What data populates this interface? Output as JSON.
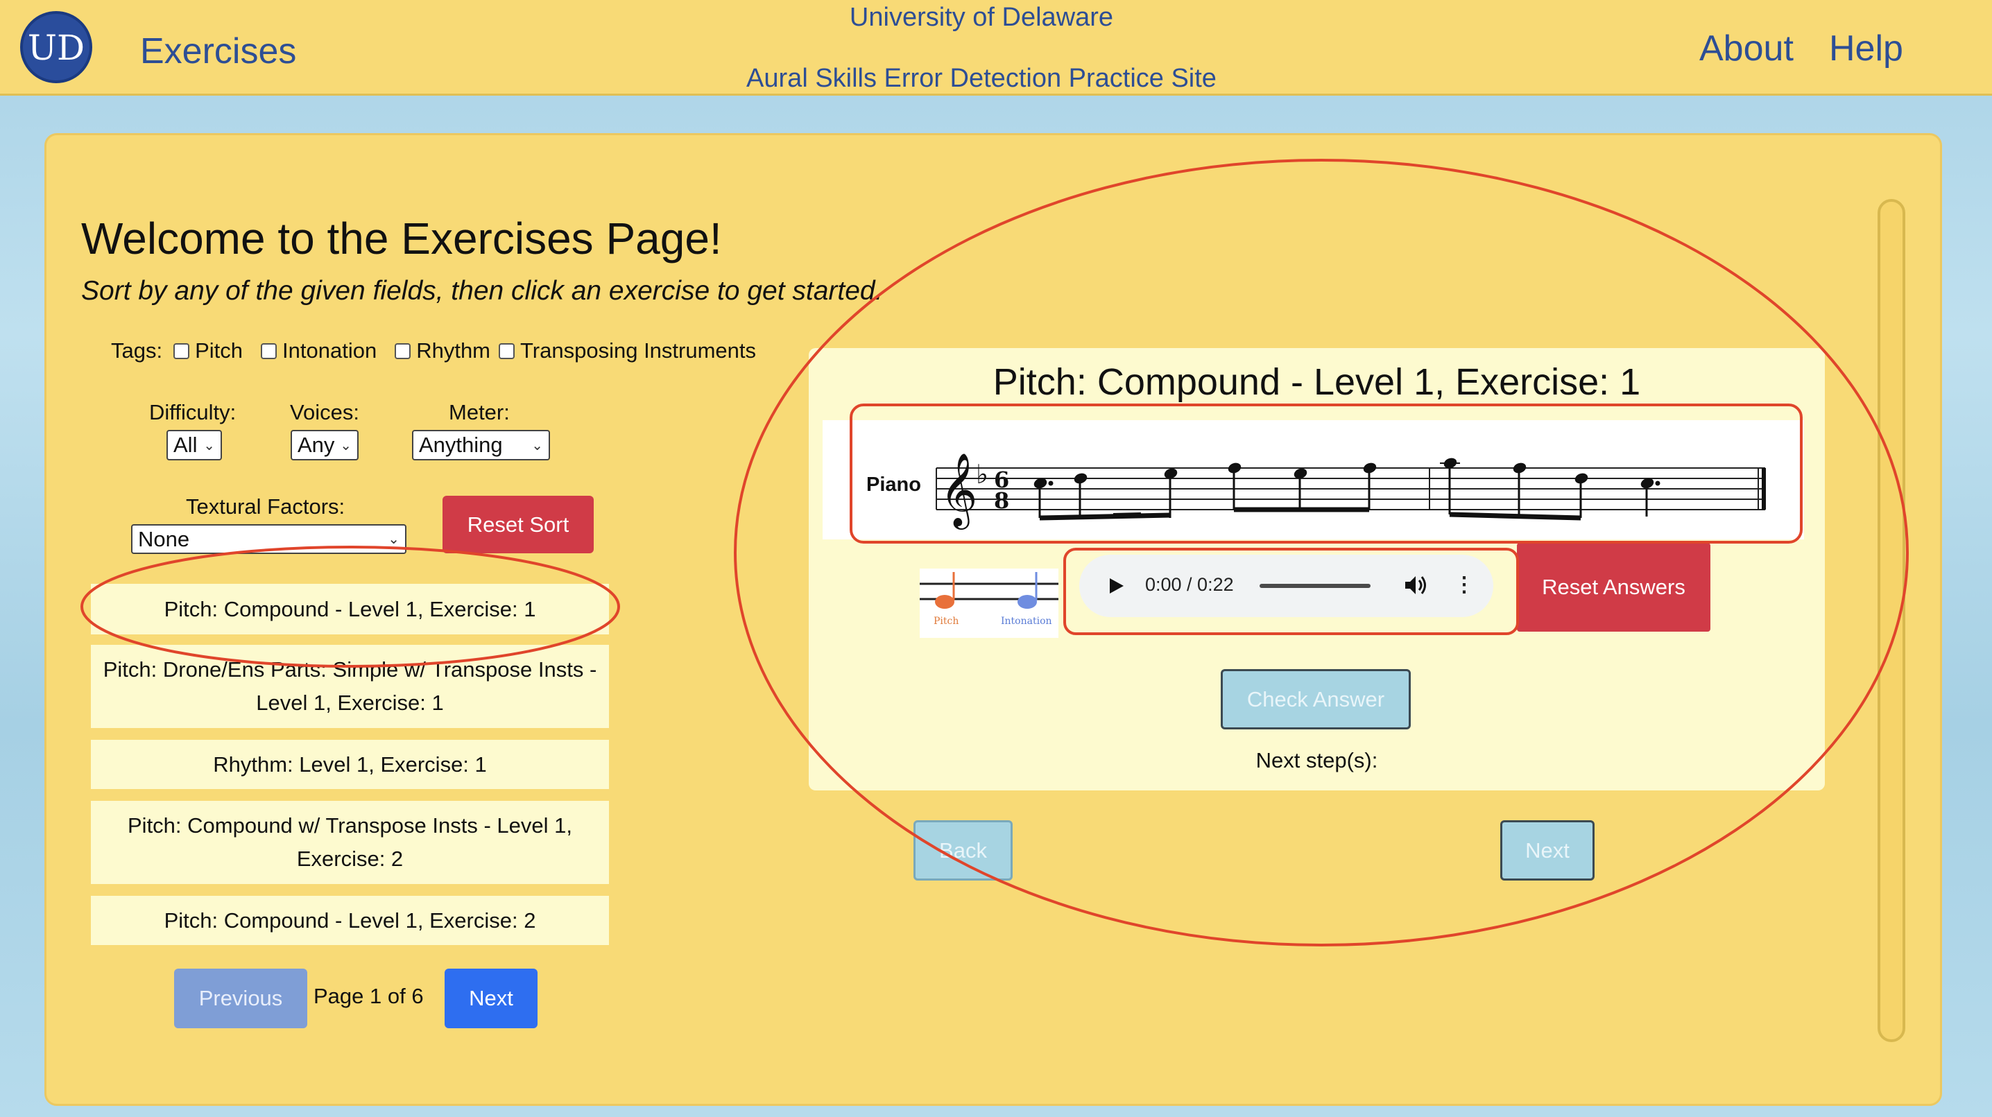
{
  "header": {
    "logo_text": "UD",
    "brand": "Exercises",
    "line1": "University of Delaware",
    "line2": "Aural Skills Error Detection Practice Site",
    "nav": {
      "about": "About",
      "help": "Help"
    }
  },
  "main": {
    "title": "Welcome to the Exercises Page!",
    "subtitle": "Sort by any of the given fields, then click an exercise to get started.",
    "tags_label": "Tags:",
    "tags": [
      "Pitch",
      "Intonation",
      "Rhythm",
      "Transposing Instruments"
    ],
    "filters": {
      "difficulty_label": "Difficulty:",
      "difficulty_value": "All",
      "voices_label": "Voices:",
      "voices_value": "Any",
      "meter_label": "Meter:",
      "meter_value": "Anything",
      "textural_label": "Textural Factors:",
      "textural_value": "None"
    },
    "reset_sort": "Reset Sort",
    "exercises": [
      "Pitch: Compound - Level 1, Exercise: 1",
      "Pitch: Drone/Ens Parts: Simple w/ Transpose Insts - Level 1, Exercise: 1",
      "Rhythm: Level 1, Exercise: 1",
      "Pitch: Compound w/ Transpose Insts - Level 1, Exercise: 2",
      "Pitch: Compound - Level 1, Exercise: 2"
    ],
    "pagination": {
      "previous": "Previous",
      "indicator": "Page 1 of 6",
      "next": "Next"
    }
  },
  "exercise": {
    "title": "Pitch: Compound - Level 1, Exercise: 1",
    "instrument": "Piano",
    "legend": {
      "pitch": "Pitch",
      "intonation": "Intonation"
    },
    "audio": {
      "time": "0:00 / 0:22"
    },
    "reset_answers": "Reset Answers",
    "check_answer": "Check Answer",
    "next_steps": "Next step(s):",
    "back": "Back",
    "next": "Next"
  },
  "colors": {
    "header_bg": "#f8da76",
    "brand_text": "#2d4e95",
    "danger": "#d03b47",
    "primary": "#2e6ef0",
    "annotation": "#e0452b"
  },
  "icons": [
    "ud-logo-icon",
    "checkbox-icon",
    "chevron-down-icon",
    "play-icon",
    "volume-icon",
    "more-vert-icon",
    "treble-clef-icon",
    "note-pitch-icon",
    "note-intonation-icon"
  ]
}
